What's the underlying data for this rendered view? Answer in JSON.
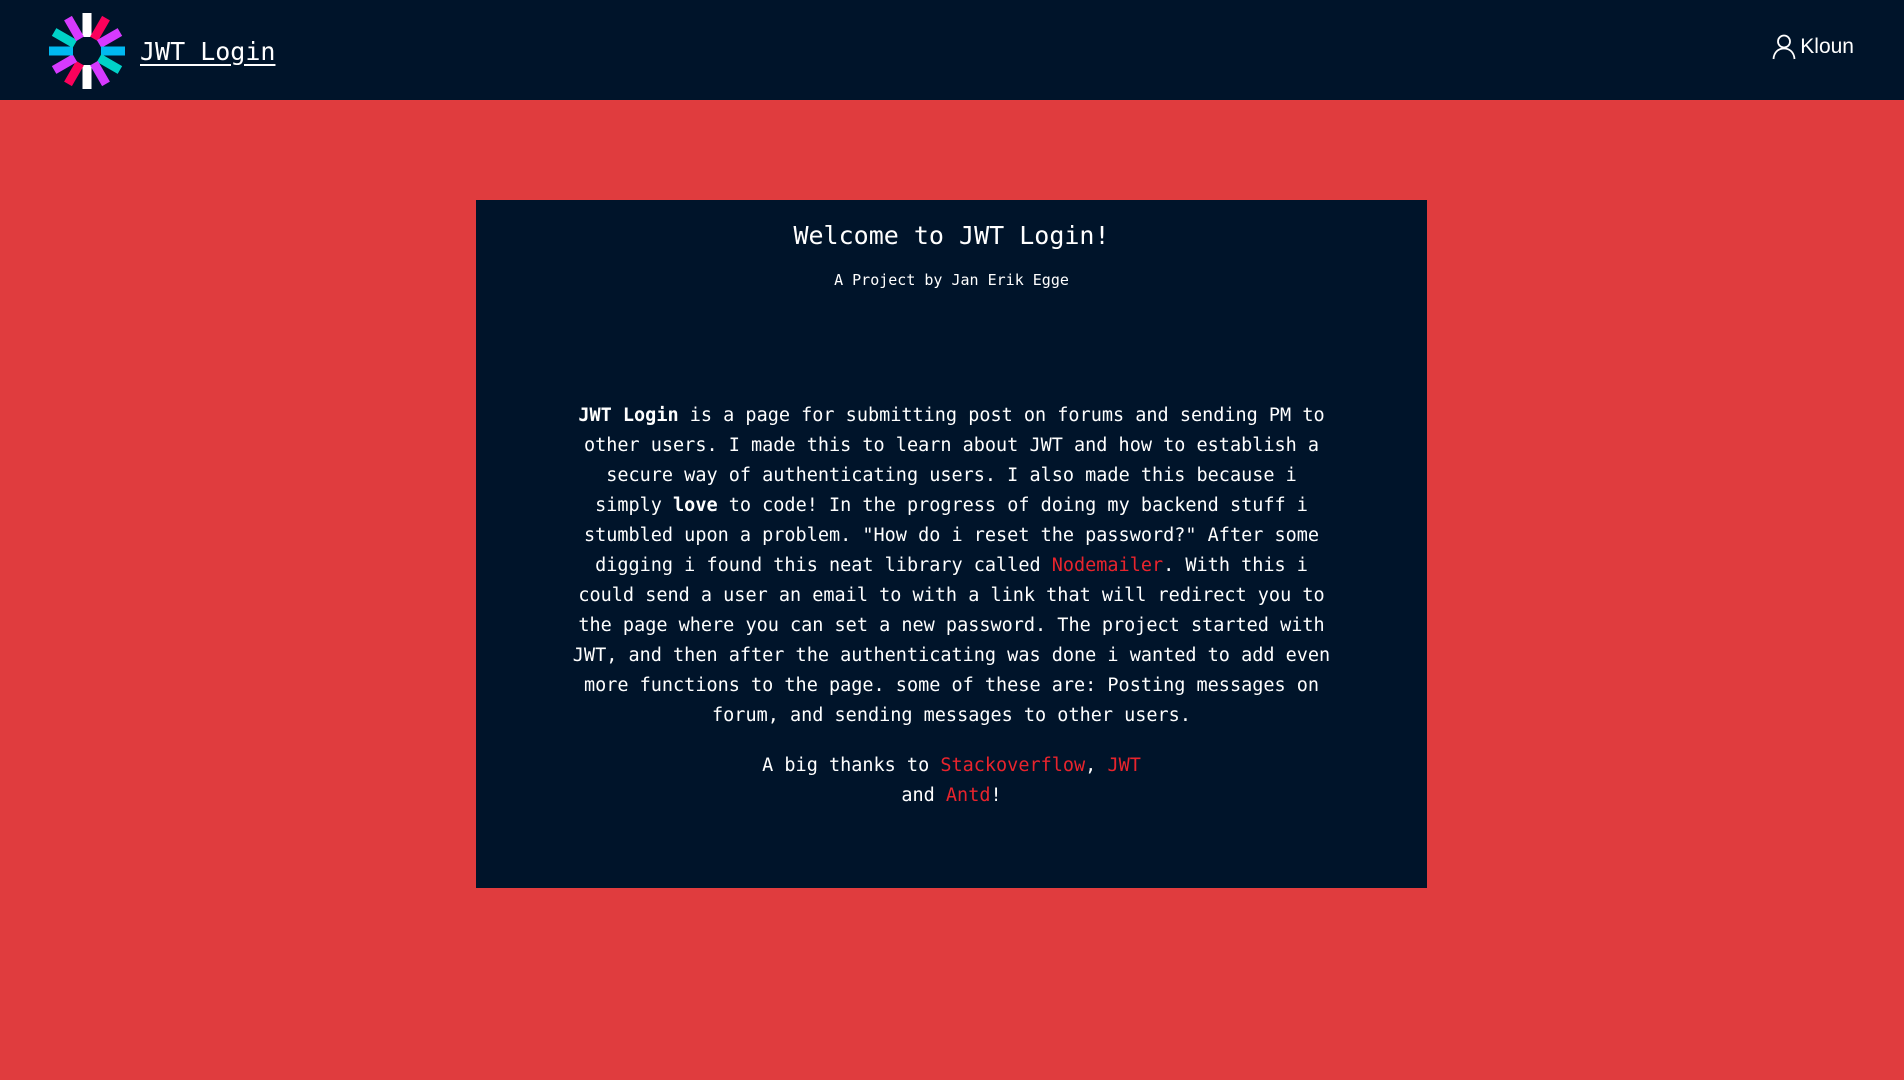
{
  "header": {
    "brand_title": "JWT Login",
    "user_name": "Kloun",
    "logo_icon": "jwt-logo-icon",
    "user_icon": "user-icon"
  },
  "card": {
    "title": "Welcome to JWT Login!",
    "subtitle": "A Project by Jan Erik Egge",
    "about": {
      "strong_name": "JWT Login",
      "text_1": " is a page for submitting post on forums and sending PM to other users. I made this to learn about JWT and how to establish a secure way of authenticating users. I also made this because i simply ",
      "strong_love": "love",
      "text_2": " to code! In the progress of doing my backend stuff i stumbled upon a problem. \"How do i reset the password?\" After some digging i found this neat library called ",
      "link_nodemailer": "Nodemailer",
      "text_3": ". With this i could send a user an email to with a link that will redirect you to the page where you can set a new password. The project started with JWT, and then after the authenticating was done i wanted to add even more functions to the page. some of these are: Posting messages on forum, and sending messages to other users."
    },
    "thanks": {
      "prefix": "A big thanks to ",
      "link_stackoverflow": "Stackoverflow",
      "sep_1": ", ",
      "link_jwt": "JWT",
      "sep_2": " and ",
      "link_antd": "Antd",
      "suffix": "!"
    }
  },
  "colors": {
    "background": "#e03c3e",
    "header": "#00142a",
    "card": "#00142a",
    "link": "#e8242d",
    "text": "#ffffff"
  }
}
